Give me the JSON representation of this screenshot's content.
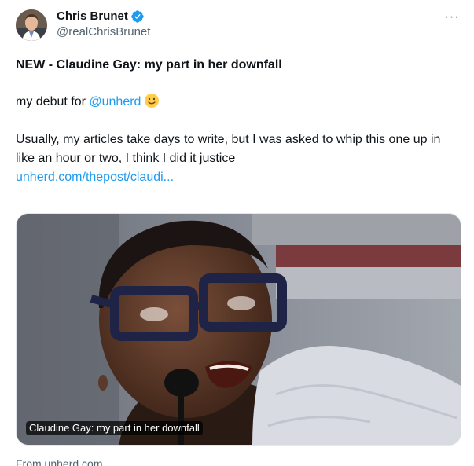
{
  "author": {
    "display_name": "Chris Brunet",
    "handle": "@realChrisBrunet",
    "verified_icon": "verified-badge-icon"
  },
  "menu": {
    "more_label": "···"
  },
  "tweet": {
    "title": "NEW - Claudine Gay: my part in her downfall",
    "debut_prefix": "my debut for ",
    "mention": "@unherd",
    "emoji_icon": "slightly-smiling-face-icon",
    "paragraph": "Usually, my articles take days to write, but I was asked to whip this one up in like an hour or two, I think I did it justice",
    "link": "unherd.com/thepost/claudi..."
  },
  "card": {
    "caption": "Claudine Gay: my part in her downfall",
    "source": "From unherd.com"
  },
  "colors": {
    "link": "#1d9bf0",
    "verified": "#1d9bf0",
    "text": "#0f1419",
    "muted": "#536471"
  }
}
